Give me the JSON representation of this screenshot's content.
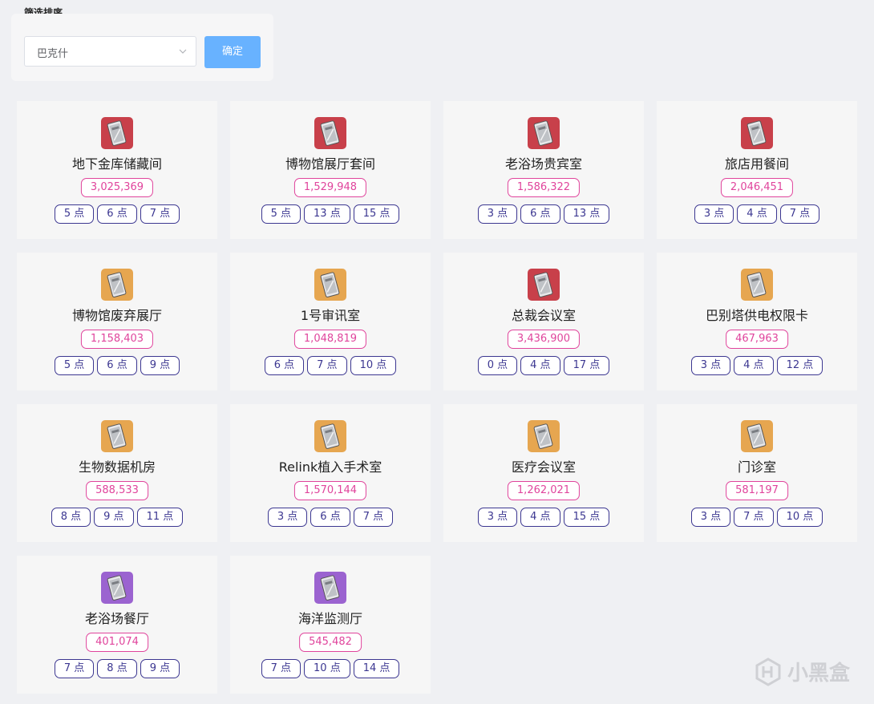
{
  "filter": {
    "title": "筛选排序",
    "selected": "巴克什",
    "confirm_label": "确定"
  },
  "cards": [
    {
      "name": "地下金库储藏间",
      "price": "3,025,369",
      "icon": "red-keycard-icon",
      "points": [
        "5 点",
        "6 点",
        "7 点"
      ]
    },
    {
      "name": "博物馆展厅套间",
      "price": "1,529,948",
      "icon": "red-keycard-icon",
      "points": [
        "5 点",
        "13 点",
        "15 点"
      ]
    },
    {
      "name": "老浴场贵宾室",
      "price": "1,586,322",
      "icon": "red-keycard-icon",
      "points": [
        "3 点",
        "6 点",
        "13 点"
      ]
    },
    {
      "name": "旅店用餐间",
      "price": "2,046,451",
      "icon": "red-keycard-icon",
      "points": [
        "3 点",
        "4 点",
        "7 点"
      ]
    },
    {
      "name": "博物馆废弃展厅",
      "price": "1,158,403",
      "icon": "gold-keycard-icon",
      "points": [
        "5 点",
        "6 点",
        "9 点"
      ]
    },
    {
      "name": "1号审讯室",
      "price": "1,048,819",
      "icon": "gold-keycard-icon",
      "points": [
        "6 点",
        "7 点",
        "10 点"
      ]
    },
    {
      "name": "总裁会议室",
      "price": "3,436,900",
      "icon": "red-keycard-icon",
      "points": [
        "0 点",
        "4 点",
        "17 点"
      ]
    },
    {
      "name": "巴别塔供电权限卡",
      "price": "467,963",
      "icon": "gold-keycard-icon",
      "points": [
        "3 点",
        "4 点",
        "12 点"
      ]
    },
    {
      "name": "生物数据机房",
      "price": "588,533",
      "icon": "gold-keycard-icon",
      "points": [
        "8 点",
        "9 点",
        "11 点"
      ]
    },
    {
      "name": "Relink植入手术室",
      "price": "1,570,144",
      "icon": "gold-keycard-icon",
      "points": [
        "3 点",
        "6 点",
        "7 点"
      ]
    },
    {
      "name": "医疗会议室",
      "price": "1,262,021",
      "icon": "gold-keycard-icon",
      "points": [
        "3 点",
        "4 点",
        "15 点"
      ]
    },
    {
      "name": "门诊室",
      "price": "581,197",
      "icon": "gold-keycard-icon",
      "points": [
        "3 点",
        "7 点",
        "10 点"
      ]
    },
    {
      "name": "老浴场餐厅",
      "price": "401,074",
      "icon": "purple-keycard-icon",
      "points": [
        "7 点",
        "8 点",
        "9 点"
      ]
    },
    {
      "name": "海洋监测厅",
      "price": "545,482",
      "icon": "purple-keycard-icon",
      "points": [
        "7 点",
        "10 点",
        "14 点"
      ]
    }
  ],
  "colors": {
    "red-keycard-icon": "#c8404a",
    "gold-keycard-icon": "#e6a650",
    "purple-keycard-icon": "#9b63d0",
    "price_accent": "#e0449c",
    "point_accent": "#3c3791",
    "confirm_bg": "#68b2ff"
  },
  "watermark": "小黑盒"
}
